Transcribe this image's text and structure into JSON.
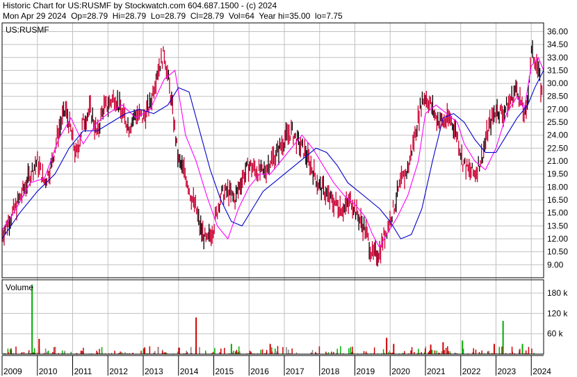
{
  "header": {
    "title_line": "Historic Chart for US:RUSMF by Stockwatch.com 604.687.1500 - (c) 2024",
    "quote_line": "Mon Apr 29 2024  Op=28.79  Hi=28.79  Lo=28.79  Cl=28.79  Vol=64  Year hi=35.00  lo=7.75"
  },
  "chart_data": [
    {
      "type": "line",
      "title": "US:RUSMF",
      "price_axis": {
        "ticks": [
          "36.00",
          "34.50",
          "33.00",
          "31.50",
          "30.00",
          "28.50",
          "27.00",
          "25.50",
          "24.00",
          "22.50",
          "21.00",
          "19.50",
          "18.00",
          "16.50",
          "15.00",
          "13.50",
          "12.00",
          "10.50",
          "9.00"
        ],
        "range": [
          7.5,
          37.0
        ]
      },
      "x_axis": {
        "labels": [
          "2009",
          "2010",
          "2011",
          "2012",
          "2013",
          "2014",
          "2015",
          "2016",
          "2017",
          "2018",
          "2019",
          "2020",
          "2021",
          "2022",
          "2023",
          "2024"
        ],
        "range": [
          2009.0,
          2024.35
        ]
      },
      "colors": {
        "price": "#cc0033",
        "fast_ma": "#ff00ff",
        "slow_ma": "#0000cc",
        "up": "#00aa00",
        "down": "#cc0000",
        "grid": "#c0c0c0"
      },
      "series": [
        {
          "role": "price",
          "x": [
            2009.0,
            2009.3,
            2009.6,
            2009.8,
            2010.0,
            2010.2,
            2010.4,
            2010.6,
            2010.8,
            2010.95,
            2011.1,
            2011.3,
            2011.5,
            2011.7,
            2011.85,
            2012.0,
            2012.2,
            2012.4,
            2012.6,
            2012.8,
            2013.0,
            2013.2,
            2013.4,
            2013.6,
            2013.8,
            2014.0,
            2014.2,
            2014.35,
            2014.5,
            2014.6,
            2014.8,
            2015.0,
            2015.2,
            2015.4,
            2015.6,
            2015.8,
            2016.0,
            2016.2,
            2016.4,
            2016.6,
            2016.8,
            2017.0,
            2017.2,
            2017.4,
            2017.6,
            2017.8,
            2018.0,
            2018.15,
            2018.3,
            2018.5,
            2018.7,
            2018.9,
            2019.1,
            2019.3,
            2019.5,
            2019.7,
            2019.8,
            2019.9,
            2020.1,
            2020.3,
            2020.5,
            2020.7,
            2020.9,
            2021.0,
            2021.15,
            2021.3,
            2021.5,
            2021.7,
            2021.9,
            2022.05,
            2022.2,
            2022.4,
            2022.6,
            2022.8,
            2023.0,
            2023.2,
            2023.4,
            2023.6,
            2023.75,
            2023.85,
            2024.0,
            2024.15,
            2024.3
          ],
          "y": [
            12.5,
            15.0,
            17.5,
            19.5,
            21.0,
            18.5,
            20.5,
            24.5,
            27.0,
            24.5,
            21.5,
            25.5,
            27.0,
            24.0,
            27.0,
            27.5,
            28.5,
            26.5,
            25.0,
            26.5,
            26.0,
            27.5,
            31.5,
            33.5,
            28.0,
            21.0,
            19.5,
            17.0,
            15.5,
            13.5,
            11.5,
            13.5,
            17.0,
            17.5,
            16.5,
            19.0,
            20.5,
            20.0,
            19.5,
            21.0,
            22.0,
            23.5,
            24.5,
            23.0,
            22.0,
            20.0,
            18.0,
            17.5,
            16.5,
            16.0,
            15.5,
            16.5,
            14.5,
            13.0,
            10.0,
            10.5,
            12.0,
            13.0,
            15.5,
            18.5,
            20.0,
            24.0,
            28.0,
            28.5,
            27.5,
            26.0,
            25.5,
            26.0,
            24.0,
            21.0,
            20.0,
            19.5,
            21.5,
            25.0,
            27.0,
            26.5,
            28.0,
            29.5,
            27.0,
            26.0,
            33.5,
            32.5,
            28.8
          ]
        },
        {
          "role": "fast_ma",
          "x": [
            2009.0,
            2009.4,
            2009.8,
            2010.2,
            2010.6,
            2010.95,
            2011.3,
            2011.7,
            2012.0,
            2012.4,
            2012.8,
            2013.2,
            2013.6,
            2013.9,
            2014.2,
            2014.5,
            2014.8,
            2015.1,
            2015.4,
            2015.7,
            2016.0,
            2016.3,
            2016.6,
            2016.9,
            2017.2,
            2017.5,
            2017.8,
            2018.1,
            2018.4,
            2018.7,
            2019.0,
            2019.3,
            2019.5,
            2019.7,
            2019.9,
            2020.2,
            2020.5,
            2020.8,
            2021.0,
            2021.3,
            2021.6,
            2021.9,
            2022.1,
            2022.4,
            2022.7,
            2023.0,
            2023.3,
            2023.6,
            2023.8,
            2024.0,
            2024.2,
            2024.35
          ],
          "y": [
            13.0,
            15.5,
            18.5,
            19.0,
            23.5,
            26.0,
            23.0,
            25.5,
            26.5,
            27.5,
            26.0,
            27.0,
            30.5,
            31.5,
            24.0,
            21.0,
            17.0,
            13.5,
            12.0,
            15.5,
            18.0,
            19.5,
            19.5,
            21.0,
            22.5,
            24.0,
            22.5,
            20.5,
            18.5,
            17.0,
            16.0,
            14.5,
            12.5,
            11.0,
            12.5,
            14.5,
            17.0,
            21.0,
            26.5,
            27.5,
            26.5,
            25.5,
            23.0,
            21.0,
            20.0,
            22.5,
            26.5,
            28.5,
            27.0,
            32.0,
            33.0,
            31.5
          ]
        },
        {
          "role": "slow_ma",
          "x": [
            2009.0,
            2009.5,
            2010.0,
            2010.5,
            2010.9,
            2011.3,
            2011.7,
            2012.1,
            2012.5,
            2012.9,
            2013.3,
            2013.7,
            2014.0,
            2014.3,
            2014.6,
            2014.9,
            2015.2,
            2015.5,
            2015.8,
            2016.1,
            2016.4,
            2016.7,
            2017.0,
            2017.3,
            2017.6,
            2017.9,
            2018.2,
            2018.5,
            2018.8,
            2019.1,
            2019.4,
            2019.7,
            2020.0,
            2020.3,
            2020.6,
            2020.9,
            2021.2,
            2021.5,
            2021.8,
            2022.1,
            2022.4,
            2022.7,
            2023.0,
            2023.3,
            2023.6,
            2023.9,
            2024.1,
            2024.35
          ],
          "y": [
            12.0,
            15.0,
            17.5,
            19.5,
            22.5,
            24.5,
            24.5,
            25.5,
            26.5,
            27.0,
            26.5,
            27.5,
            29.5,
            29.0,
            24.5,
            20.0,
            16.5,
            14.0,
            13.5,
            15.5,
            17.5,
            18.5,
            19.5,
            20.5,
            21.5,
            22.5,
            22.0,
            20.5,
            18.5,
            17.5,
            16.5,
            15.5,
            14.0,
            12.0,
            12.5,
            15.5,
            21.0,
            26.0,
            26.5,
            25.5,
            23.5,
            22.0,
            22.0,
            24.0,
            26.0,
            27.5,
            29.5,
            31.5
          ]
        }
      ]
    },
    {
      "type": "bar",
      "title": "Volume",
      "volume_axis": {
        "ticks": [
          "180 k",
          "120 k",
          "60 k"
        ],
        "range": [
          0,
          215000
        ]
      },
      "spikes": [
        {
          "x": 2009.85,
          "value": 205000,
          "dir": "up"
        },
        {
          "x": 2010.05,
          "value": 45000,
          "dir": "down"
        },
        {
          "x": 2014.5,
          "value": 108000,
          "dir": "down"
        },
        {
          "x": 2015.5,
          "value": 30000,
          "dir": "up"
        },
        {
          "x": 2016.6,
          "value": 30000,
          "dir": "down"
        },
        {
          "x": 2019.9,
          "value": 48000,
          "dir": "down"
        },
        {
          "x": 2020.1,
          "value": 30000,
          "dir": "down"
        },
        {
          "x": 2021.15,
          "value": 28000,
          "dir": "down"
        },
        {
          "x": 2021.5,
          "value": 35000,
          "dir": "down"
        },
        {
          "x": 2022.05,
          "value": 40000,
          "dir": "up"
        },
        {
          "x": 2022.95,
          "value": 30000,
          "dir": "down"
        },
        {
          "x": 2023.2,
          "value": 98000,
          "dir": "up"
        },
        {
          "x": 2023.75,
          "value": 30000,
          "dir": "up"
        }
      ]
    }
  ]
}
